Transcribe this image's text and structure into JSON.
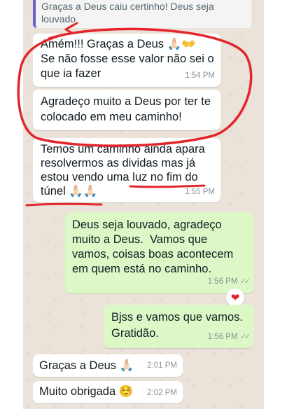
{
  "quoted": {
    "text_line1": "Graças a Deus caiu certinho! Deus seja",
    "text_line2": "louvado"
  },
  "messages": [
    {
      "dir": "in",
      "lines": [
        "Amém!!! Graças a Deus 🙏🏻👐",
        "Se não fosse esse valor não sei o",
        "que ia fazer"
      ],
      "time": "1:54 PM"
    },
    {
      "dir": "in",
      "lines": [
        "Agradeço muito a Deus por ter te",
        "colocado em meu caminho!"
      ],
      "time": ""
    },
    {
      "dir": "in",
      "lines": [
        "Temos um caminho ainda apara",
        "resolvermos as dividas mas já",
        "estou vendo uma luz no fim do",
        "túnel 🙏🏻🙏🏻"
      ],
      "time": "1:55 PM"
    },
    {
      "dir": "out",
      "lines": [
        "Deus seja louvado, agradeço",
        "muito a Deus.  Vamos que",
        "vamos, coisas boas acontecem",
        "em quem está no caminho."
      ],
      "time": "1:56 PM",
      "ticks": "✓✓",
      "reaction": "❤"
    },
    {
      "dir": "out",
      "lines": [
        "Bjss e vamos que vamos.",
        "Gratidão."
      ],
      "time": "1:56 PM",
      "ticks": "✓✓"
    },
    {
      "dir": "in",
      "lines": [
        "Graças a Deus 🙏🏻"
      ],
      "time": "2:01 PM"
    },
    {
      "dir": "in",
      "lines": [
        "Muito obrigada ☺️"
      ],
      "time": "2:02 PM"
    }
  ],
  "colors": {
    "incoming": "#ffffff",
    "outgoing": "#dcf8c6",
    "annotation": "#e3262b",
    "quote_bar": "#6b5bd2"
  }
}
